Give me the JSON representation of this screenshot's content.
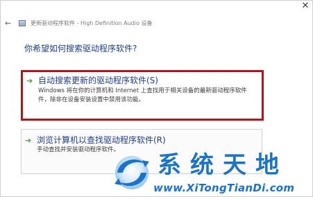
{
  "window": {
    "close_label": "✕",
    "back_label": "←",
    "title": "更新驱动程序软件 - High Definition Audio 设备"
  },
  "main": {
    "heading": "你希望如何搜索驱动程序软件?",
    "options": [
      {
        "icon": "green-arrow-icon",
        "title": "自动搜索更新的驱动程序软件(S)",
        "description_lines": [
          "Windows 将在你的计算机和 Internet 上查找用于相关设备的最新驱动程序软件",
          "件，除非在设备安装设置中禁用该功能。"
        ],
        "highlighted": true
      },
      {
        "icon": "green-arrow-icon",
        "title": "浏览计算机以查找驱动程序软件(R)",
        "description_lines": [
          "手动查找并安装驱动程序软件。"
        ],
        "highlighted": false
      }
    ]
  },
  "watermark": {
    "title": "系统天地",
    "url": "www.XiTongTianDi.com"
  },
  "colors": {
    "accent_blue": "#1f3c88",
    "highlight_red": "#b5121b",
    "arrow_green": "#3fa142",
    "watermark_blue": "#1a73c9"
  }
}
